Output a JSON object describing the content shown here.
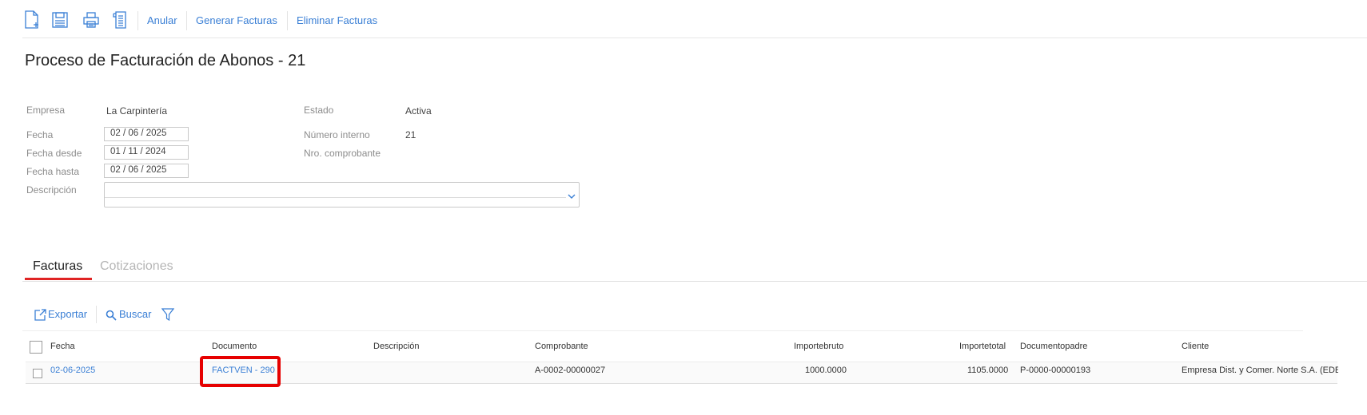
{
  "toolbar": {
    "icons": [
      "new-document-icon",
      "save-icon",
      "print-icon",
      "document-list-icon"
    ],
    "buttons": {
      "anular": "Anular",
      "generar": "Generar Facturas",
      "eliminar": "Eliminar Facturas"
    },
    "accent_color": "#3a7fd5"
  },
  "page": {
    "title": "Proceso de Facturación de Abonos - 21"
  },
  "form": {
    "empresa": {
      "label": "Empresa",
      "value": "La Carpintería"
    },
    "estado": {
      "label": "Estado",
      "value": "Activa"
    },
    "fecha": {
      "label": "Fecha",
      "value": "02 / 06 /  2025"
    },
    "numero_interno": {
      "label": "Número interno",
      "value": "21"
    },
    "fecha_desde": {
      "label": "Fecha desde",
      "value": "01 / 11 /  2024"
    },
    "nro_comprobante": {
      "label": "Nro. comprobante",
      "value": ""
    },
    "fecha_hasta": {
      "label": "Fecha hasta",
      "value": "02 / 06 /  2025"
    },
    "descripcion": {
      "label": "Descripción",
      "value": ""
    }
  },
  "tabs": [
    {
      "label": "Facturas",
      "active": true
    },
    {
      "label": "Cotizaciones",
      "active": false
    }
  ],
  "grid_toolbar": {
    "exportar": "Exportar",
    "buscar": "Buscar",
    "filter_icon": "filter-icon"
  },
  "table": {
    "columns": [
      "Fecha",
      "Documento",
      "Descripción",
      "Comprobante",
      "Importebruto",
      "Importetotal",
      "Documentopadre",
      "Cliente"
    ],
    "rows": [
      {
        "fecha": "02-06-2025",
        "documento": "FACTVEN - 290",
        "descripcion": "",
        "comprobante": "A-0002-00000027",
        "importebruto": "1000.0000",
        "importetotal": "1105.0000",
        "documentopadre": "P-0000-00000193",
        "cliente": "Empresa Dist. y Comer. Norte S.A. (EDE"
      }
    ]
  },
  "highlight_color": "#e60000"
}
